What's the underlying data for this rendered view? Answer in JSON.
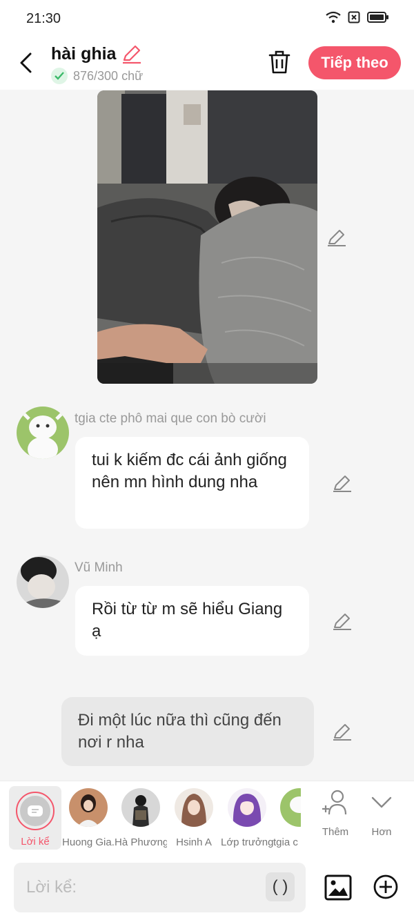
{
  "status_bar": {
    "time": "21:30"
  },
  "header": {
    "title": "hài ghia",
    "word_count": "876/300 chữ",
    "next_label": "Tiếp theo"
  },
  "messages": [
    {
      "sender": "tgia cte phô mai que con bò cười",
      "text": "tui k kiếm đc cái ảnh giống nên mn hình dung nha"
    },
    {
      "sender": "Vũ Minh",
      "text": "Rồi từ từ m sẽ hiểu Giang ạ"
    }
  ],
  "narration": {
    "text": "Đi một lúc nữa thì cũng đến nơi r nha"
  },
  "characters": [
    {
      "name": "Lời kể"
    },
    {
      "name": "Huong Gia..."
    },
    {
      "name": "Hà Phương..."
    },
    {
      "name": "Hsinh A"
    },
    {
      "name": "Lớp trưởng"
    },
    {
      "name": "tgia c"
    }
  ],
  "toolbar": {
    "add_label": "Thêm",
    "more_label": "Hơn"
  },
  "input": {
    "placeholder": "Lời kể:",
    "paren": "( )"
  },
  "colors": {
    "accent": "#f4566b",
    "background": "#f5f5f5",
    "bubble": "#ffffff",
    "narration_bubble": "#e8e8e8"
  }
}
